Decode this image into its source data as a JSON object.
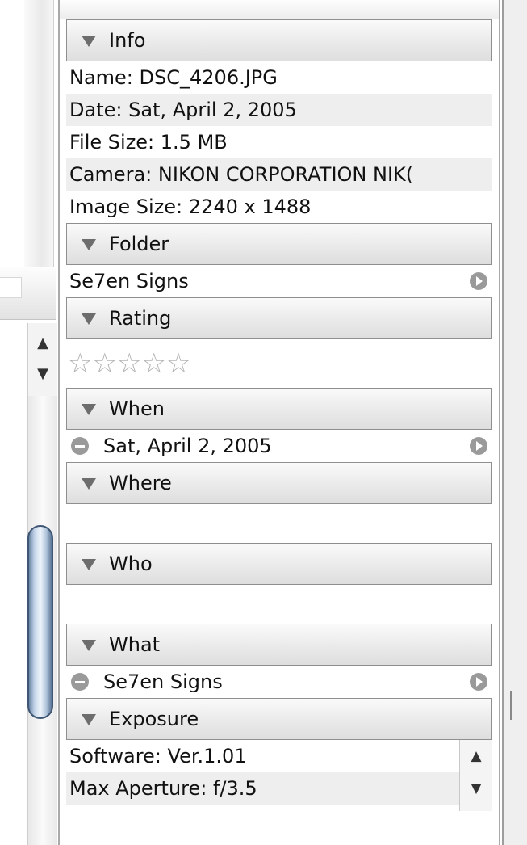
{
  "info": {
    "header": "Info",
    "rows": [
      {
        "label": "Name:",
        "value": "DSC_4206.JPG"
      },
      {
        "label": "Date:",
        "value": "Sat, April 2, 2005"
      },
      {
        "label": "File Size:",
        "value": "1.5 MB"
      },
      {
        "label": "Camera:",
        "value": "NIKON CORPORATION NIK("
      },
      {
        "label": "Image Size:",
        "value": "2240 x 1488"
      }
    ]
  },
  "folder": {
    "header": "Folder",
    "value": "Se7en Signs"
  },
  "rating": {
    "header": "Rating",
    "stars": "☆☆☆☆☆",
    "value": 0,
    "max": 5
  },
  "when": {
    "header": "When",
    "value": "Sat, April 2, 2005"
  },
  "where": {
    "header": "Where"
  },
  "who": {
    "header": "Who"
  },
  "what": {
    "header": "What",
    "value": "Se7en Signs"
  },
  "exposure": {
    "header": "Exposure",
    "rows": [
      {
        "label": "Software:",
        "value": "Ver.1.01"
      },
      {
        "label": "Max Aperture:",
        "value": "f/3.5"
      }
    ]
  },
  "scroll": {
    "up": "▲",
    "down": "▼"
  },
  "colors": {
    "header_bg": "#e6e6e6",
    "accent_scroll_thumb": "#9fb6d2",
    "alt_row": "#eeeeee"
  }
}
